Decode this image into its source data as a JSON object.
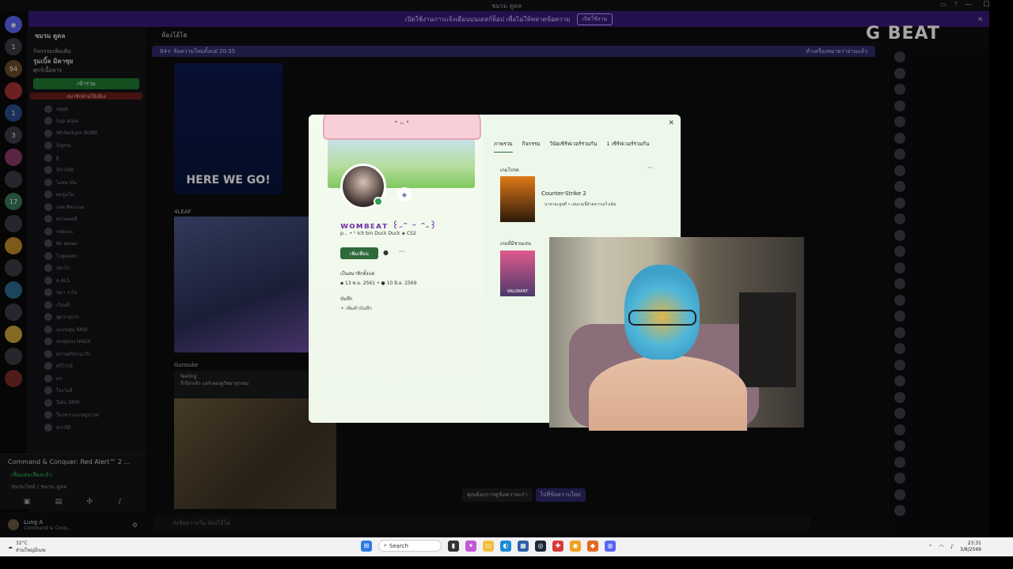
{
  "titlebar": {
    "title": "ชมรม ดูดล",
    "controls": [
      "—",
      "☐",
      "✕"
    ]
  },
  "banner": {
    "text": "เปิดใช้งานการแจ้งเตือนบนเดสก์ท็อป เพื่อไม่ให้พลาดข้อความ",
    "button": "เปิดใช้งาน",
    "close": "✕"
  },
  "server": {
    "name": "ชมรม ดูดล",
    "badges": [
      "1",
      "94",
      "1",
      "3",
      "17"
    ]
  },
  "channels": {
    "event_tag": "กิจกรรมเพิ่มเติม",
    "event_title": "รุมเบิ้ล มิคาซุย",
    "event_sub": "ศุกร์เนื้อหาร",
    "join_label": "เข้าร่วม",
    "red_label": "สมาชิกห้ามใช้เสียง",
    "members": [
      "หลุยส์",
      "Sup Anjie",
      "Whiterkpm BOBB",
      "Sigma",
      "ผู้",
      "SH DSK",
      "ไม่สมาบัน",
      "ผมจูนใน",
      "กอด ศิลปะกอ",
      "ความคดดี",
      "กอดแกะ",
      "ติด ผ่อนผะ",
      "ไปลูอเลพา",
      "ปลาไร",
      "ด ALS",
      "หมา วาไล",
      "เรียนที่",
      "พูดว่าอุบาร",
      "ลุงเกยฝุ่น RAID",
      "ทรงผู้ของ NNGX",
      "ความศรีชานะวีร",
      "ศรีโวรมี",
      "ดร",
      "ใจงามดี",
      "Taku DRM",
      "ใหว่ขวากยะหมู่นารด",
      "ท่ากรีดี"
    ],
    "activity_game": "Command & Conquer: Red Alert™ 2 ...",
    "voice_status": "เชื่อมต่อเสียงแล้ว",
    "voice_sub": "ชมรมวิทย์ / ชมรม ดูดล"
  },
  "user": {
    "name": "Lung A",
    "status": "Command & Conq..."
  },
  "chat": {
    "channel": "ห้องโอ้โฮ",
    "new_messages": "84+ ข้อความใหม่ตั้งแต่ 20:35",
    "mark_read": "ทำเครื่องหมายว่าอ่านแล้ว",
    "img1_caption": "HERE WE GO!",
    "msg2_author": "4LEAF",
    "msg3_author": "Gunsuke",
    "quote_author": "feeling",
    "quote_text": "กี่เรียกเต้ว แฮร์เพลงดูวิทยาทูรเชน",
    "input_placeholder": "ส่งข้อความใน ห้องโอ้โฮ",
    "poll_a": "คุณต้องการดูข้อความเก่า",
    "poll_b": "ไปที่ข้อความใหม่"
  },
  "logo": "G BEAT",
  "profile": {
    "close": "✕",
    "sparkle": "✦✦",
    "cat_face": "• ᴗ •",
    "username": "ᴡᴏᴍʙᴇᴀᴛ ꒰˶ᵔ ᵕ ᵔ˶꒱",
    "subline": "p...  • ᵕ̈  Ich bin Duck Duck   ◈ CS2",
    "add_friend": "เพิ่มเพื่อน",
    "member_since_label": "เป็นสมาชิกตั้งแต่",
    "date_discord": "13 พ.ย. 2561",
    "date_server": "10 มิ.ย. 2569",
    "note_label": "บันทึก",
    "add_note": "เพิ่มคำบันทึก",
    "tabs": [
      "ภาพรวม",
      "กิจกรรม",
      "วินัยเซิร์ฟเวอร์ร่วมกัน",
      "1 เซิร์ฟเวอร์ร่วมกัน"
    ],
    "recent_label": "เกมโปรด",
    "game1": "Counter-Strike 2",
    "game1_meta": "นาทาละลูนที่   •   เล่นเกมนี้ด้วยความเร็วเดิม",
    "library_label": "เกมที่มีชวนเล่น",
    "game2": "VALORANT"
  },
  "taskbar": {
    "weather_temp": "32°C",
    "weather_desc": "ส่วนใหญ่มีเมฆ",
    "search": "Search",
    "time": "23:31",
    "date": "3/8/2569"
  },
  "colors": {
    "banner": "#3a1a78",
    "join": "#1f7a32",
    "accent": "#7a3ca8"
  }
}
